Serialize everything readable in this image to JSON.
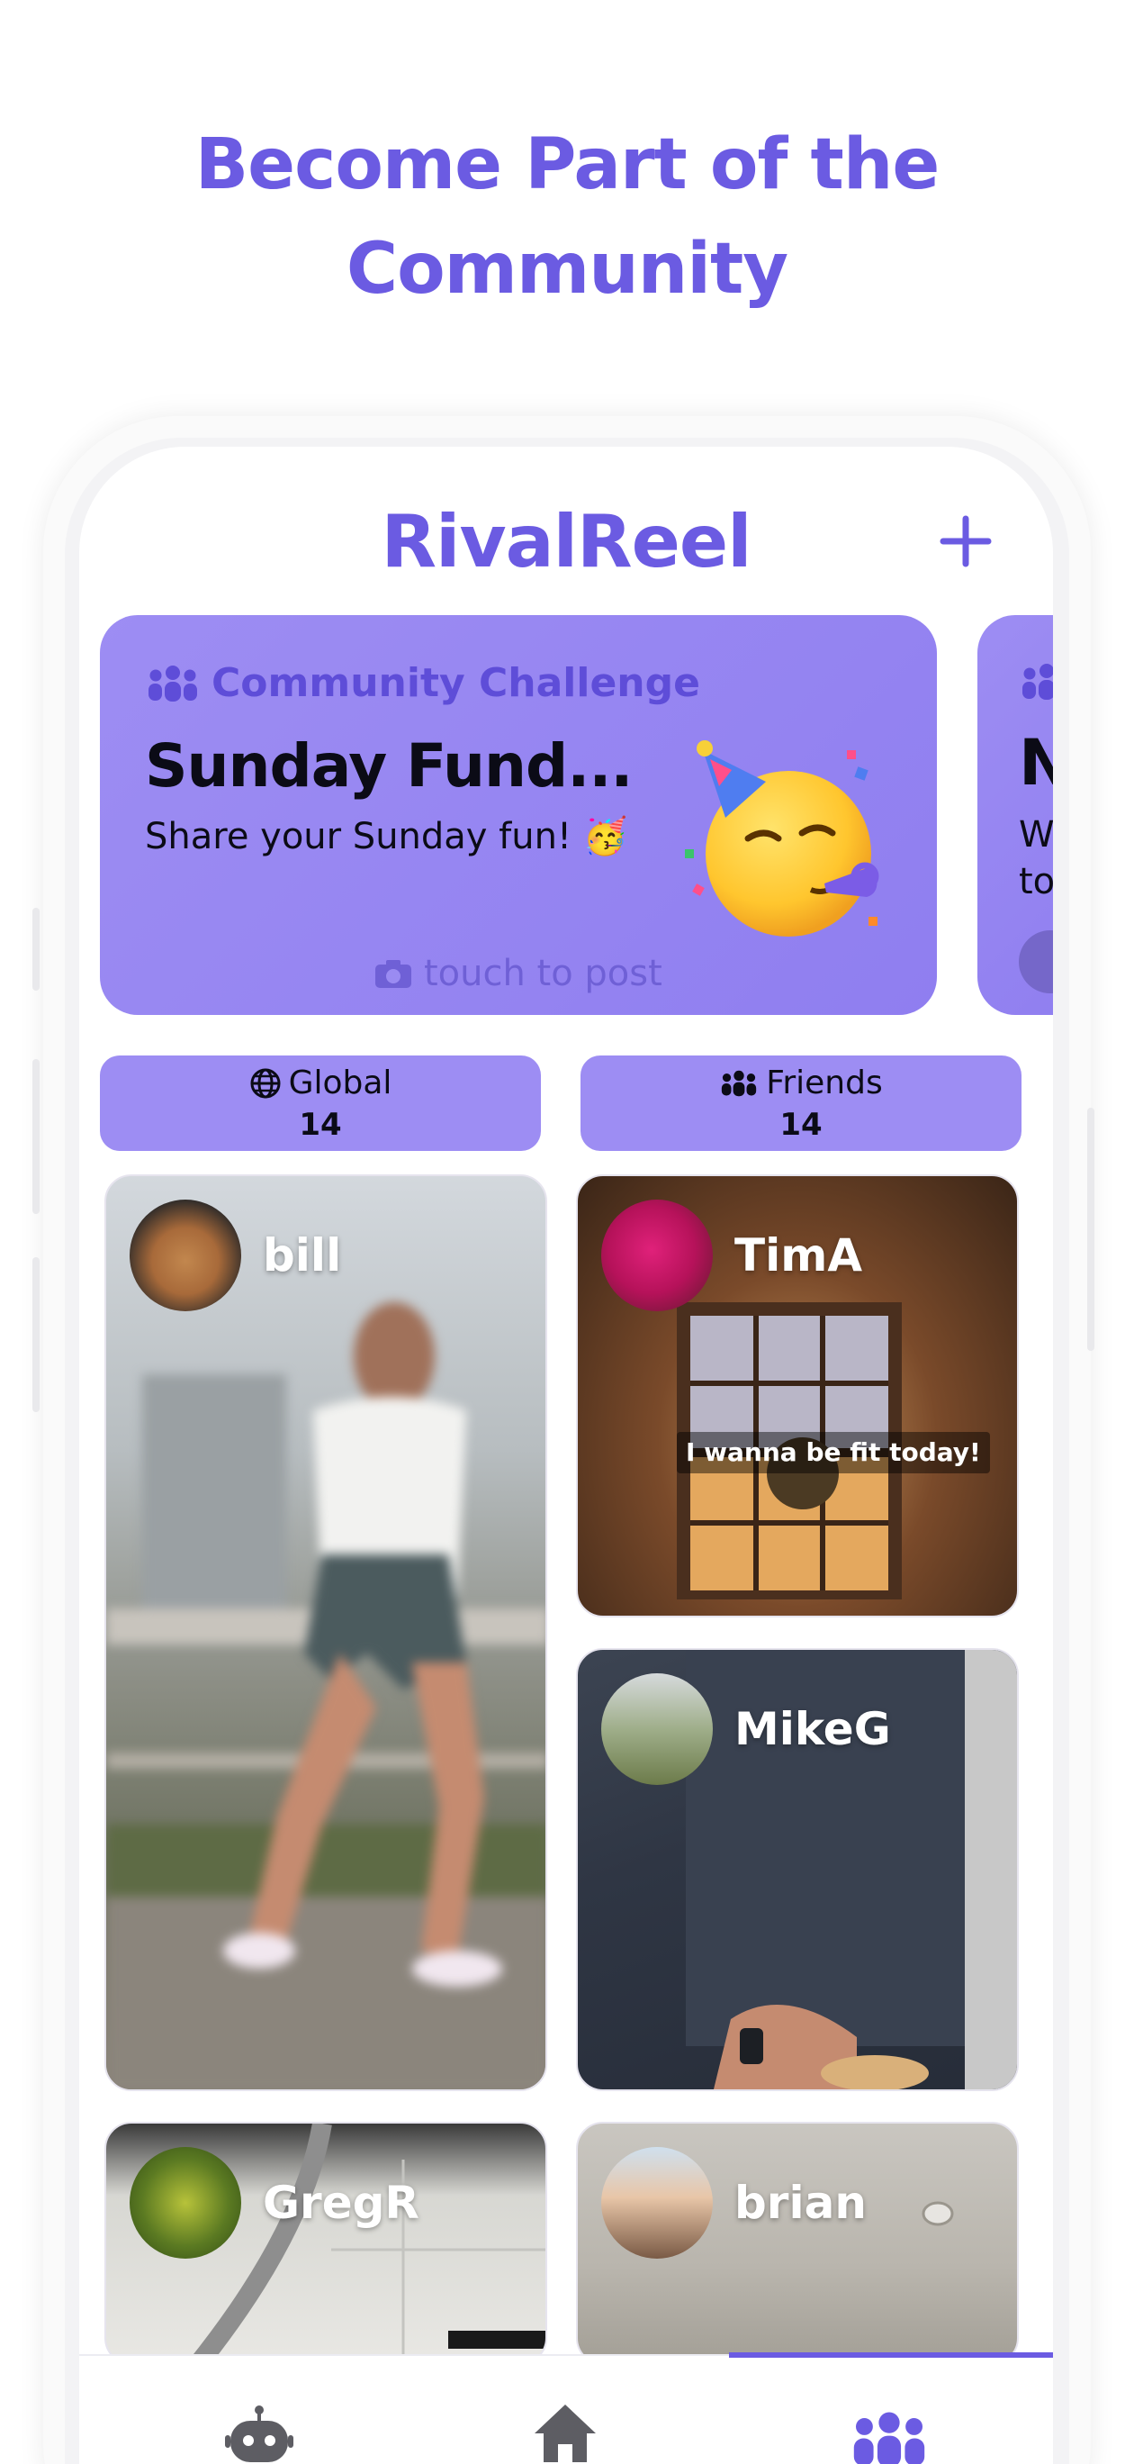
{
  "promo": {
    "headline_line1": "Become Part of the",
    "headline_line2": "Community"
  },
  "app": {
    "title": "RivalReel",
    "add_icon": "plus-icon",
    "accent_color": "#6b5be2",
    "card_color": "#9d8df3"
  },
  "challenge": {
    "tag": "Community Challenge",
    "title": "Sunday Fund...",
    "subtitle": "Share your Sunday fun! 🥳",
    "emoji": "partying-face",
    "cta": "touch to post",
    "cta_icon": "camera-icon"
  },
  "next_challenge_peek": {
    "title_letter": "N",
    "subtitle_lines": [
      "W",
      "to"
    ]
  },
  "stats": [
    {
      "label": "Global",
      "value": "14",
      "icon": "globe-icon"
    },
    {
      "label": "Friends",
      "value": "14",
      "icon": "people-icon"
    }
  ],
  "posts": [
    {
      "user": "bill"
    },
    {
      "user": "TimA",
      "caption": "I wanna be fit today!"
    },
    {
      "user": "MikeG"
    },
    {
      "user": "GregR"
    },
    {
      "user": "brian"
    }
  ],
  "tabbar": {
    "tabs": [
      {
        "name": "bot",
        "icon": "robot-icon"
      },
      {
        "name": "home",
        "icon": "home-icon"
      },
      {
        "name": "community",
        "icon": "community-icon",
        "active": true
      }
    ]
  }
}
